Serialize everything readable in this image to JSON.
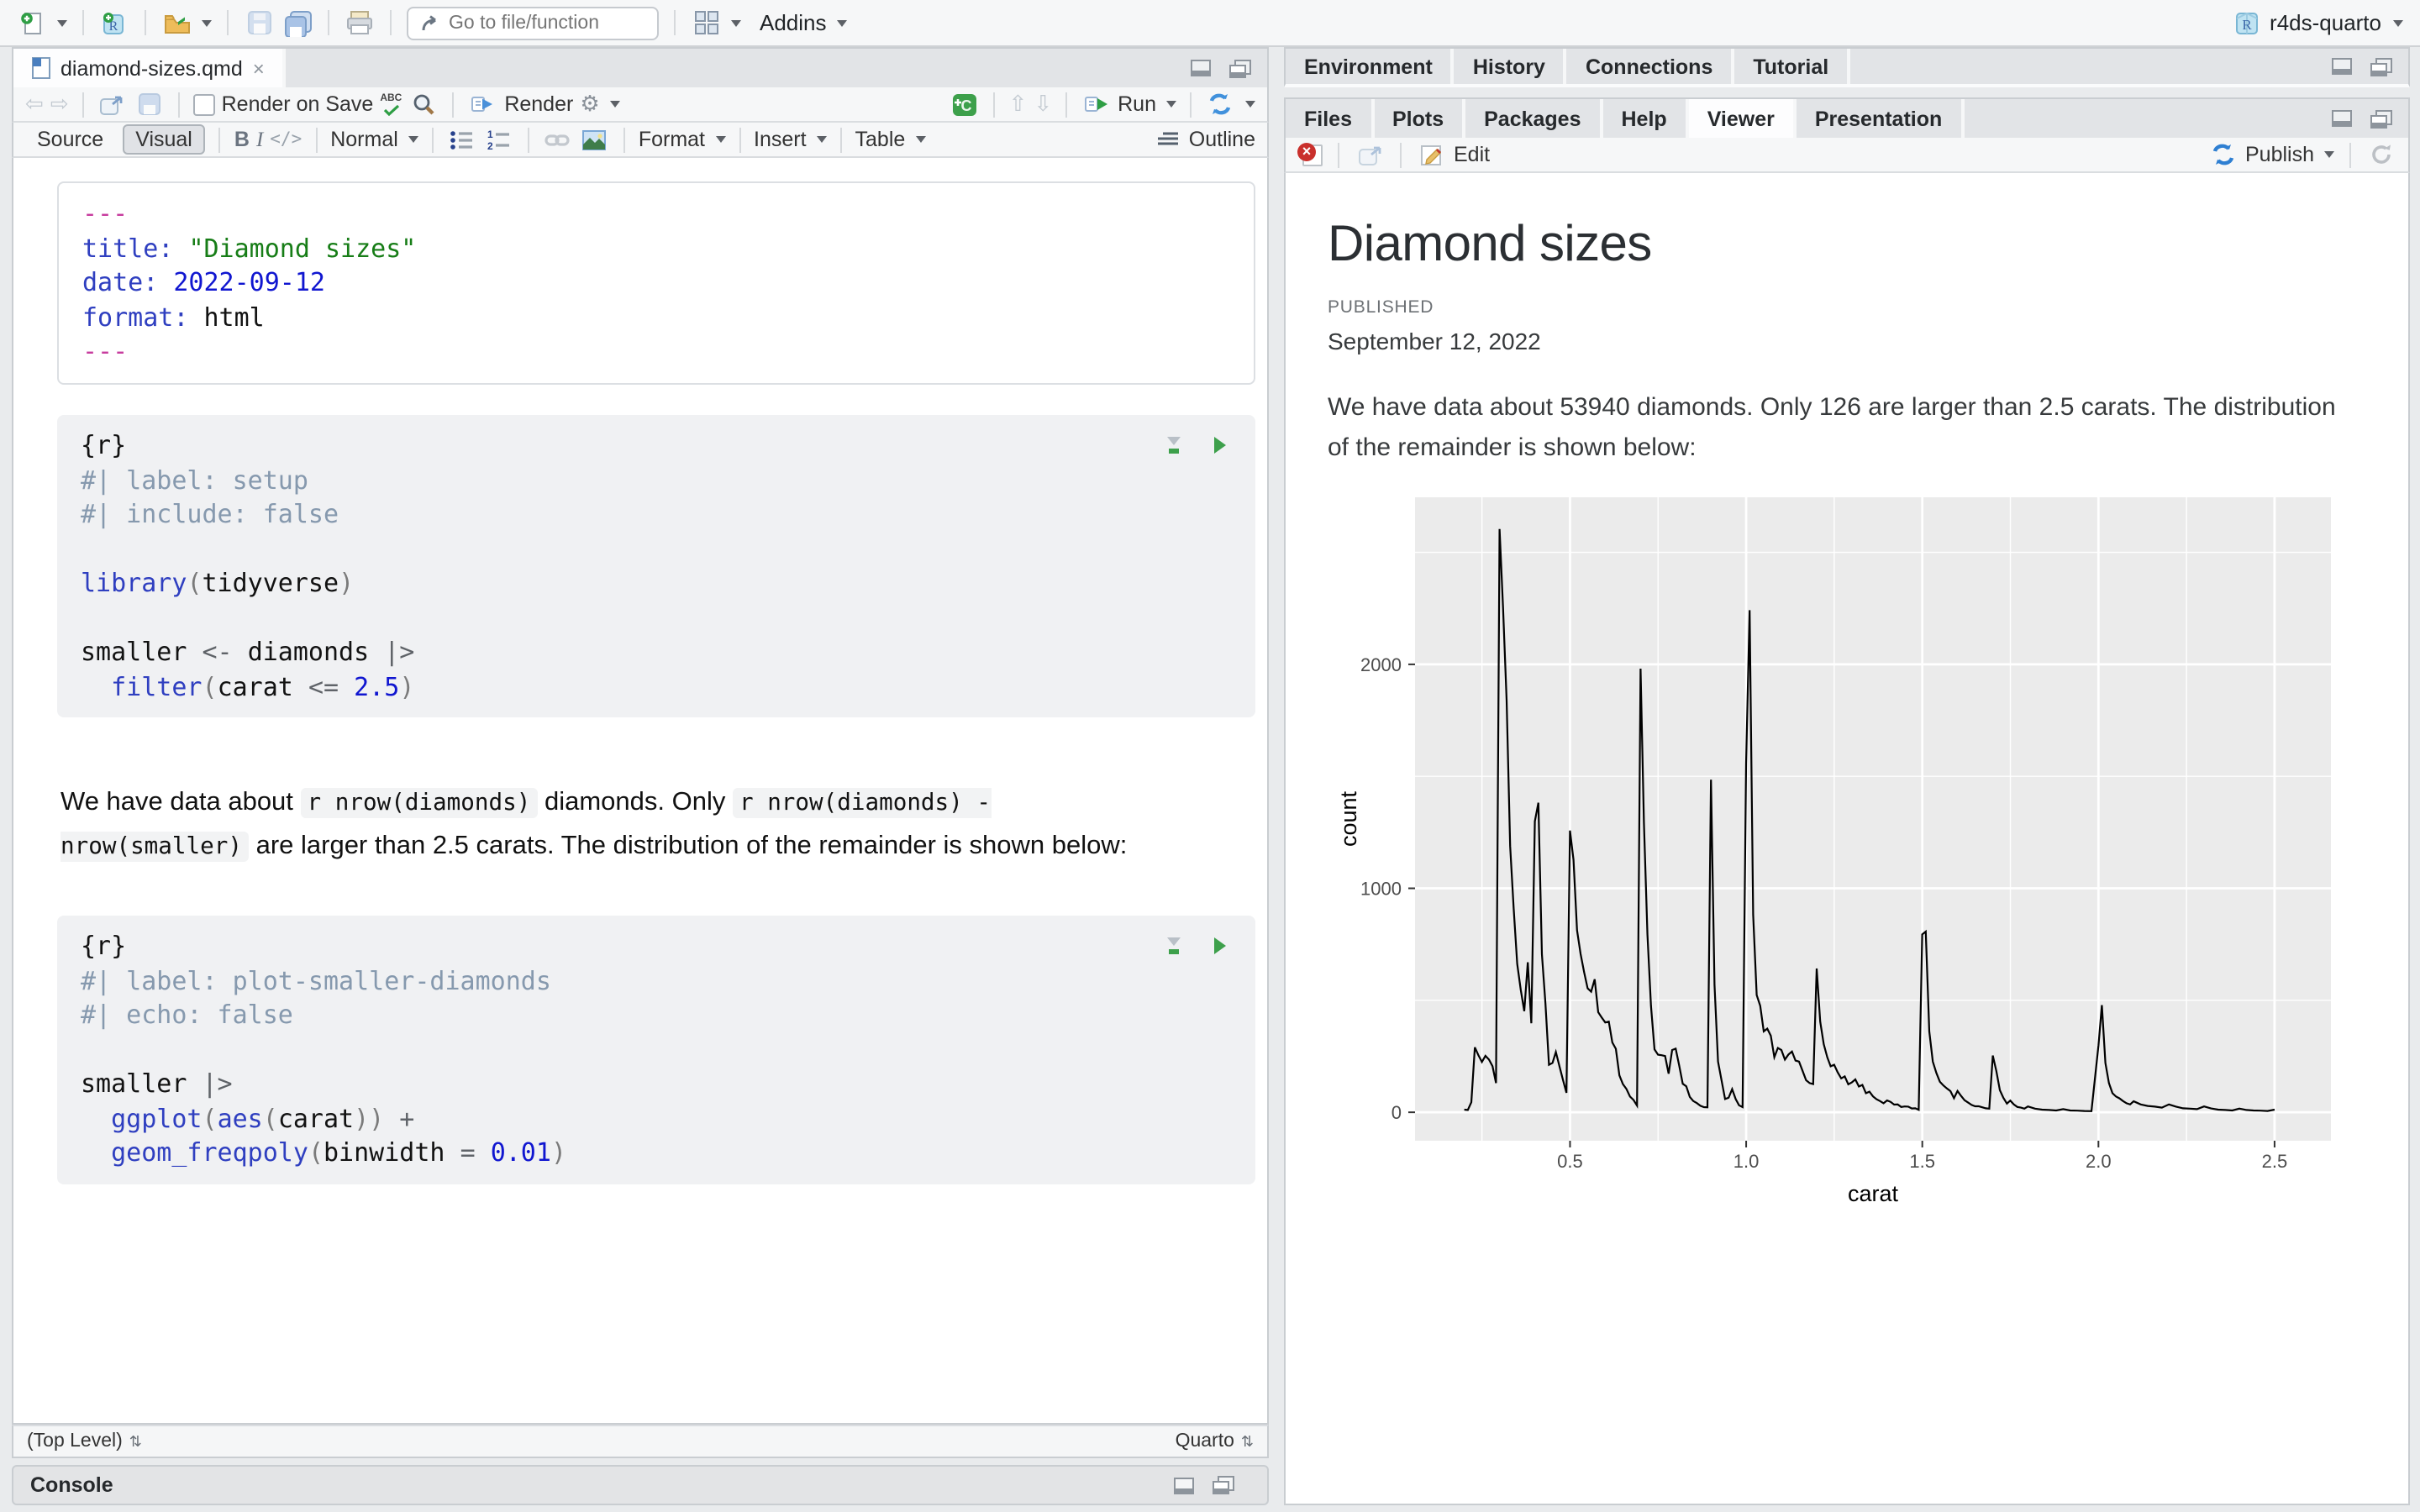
{
  "topbar": {
    "goto_placeholder": "Go to file/function",
    "addins_label": "Addins",
    "project_name": "r4ds-quarto"
  },
  "left": {
    "tab": {
      "filename": "diamond-sizes.qmd",
      "close": "×"
    },
    "toolbar": {
      "render_on_save": "Render on Save",
      "render": "Render",
      "run": "Run"
    },
    "formatbar": {
      "source": "Source",
      "visual": "Visual",
      "bold": "B",
      "italic": "I",
      "code": "</>",
      "normal": "Normal",
      "format": "Format",
      "insert": "Insert",
      "table": "Table",
      "outline": "Outline"
    },
    "editor": {
      "yaml_lines": [
        [
          [
            "y",
            "---"
          ]
        ],
        [
          [
            "k",
            "title: "
          ],
          [
            "s",
            "\"Diamond sizes\""
          ]
        ],
        [
          [
            "k",
            "date: "
          ],
          [
            "n",
            "2022-09-12"
          ]
        ],
        [
          [
            "k",
            "format: "
          ],
          [
            "t",
            "html"
          ]
        ],
        [
          [
            "y",
            "---"
          ]
        ]
      ],
      "chunk1_lines": [
        [
          [
            "t",
            "{r}"
          ]
        ],
        [
          [
            "c",
            "#| label: setup"
          ]
        ],
        [
          [
            "c",
            "#| include: false"
          ]
        ],
        [],
        [
          [
            "k",
            "library"
          ],
          [
            "p",
            "("
          ],
          [
            "t",
            "tidyverse"
          ],
          [
            "p",
            ")"
          ]
        ],
        [],
        [
          [
            "t",
            "smaller "
          ],
          [
            "o",
            "<- "
          ],
          [
            "t",
            "diamonds "
          ],
          [
            "o",
            "|>"
          ]
        ],
        [
          [
            "t",
            "  "
          ],
          [
            "k",
            "filter"
          ],
          [
            "p",
            "("
          ],
          [
            "t",
            "carat "
          ],
          [
            "o",
            "<= "
          ],
          [
            "n",
            "2.5"
          ],
          [
            "p",
            ")"
          ]
        ]
      ],
      "paragraph_parts": [
        {
          "t": "text",
          "v": "We have data about "
        },
        {
          "t": "code",
          "v": "r nrow(diamonds)"
        },
        {
          "t": "text",
          "v": " diamonds. Only "
        },
        {
          "t": "code",
          "v": "r nrow(diamonds) - nrow(smaller)"
        },
        {
          "t": "text",
          "v": " are larger than 2.5 carats. The distribution of the remainder is shown below:"
        }
      ],
      "chunk2_lines": [
        [
          [
            "t",
            "{r}"
          ]
        ],
        [
          [
            "c",
            "#| label: plot-smaller-diamonds"
          ]
        ],
        [
          [
            "c",
            "#| echo: false"
          ]
        ],
        [],
        [
          [
            "t",
            "smaller "
          ],
          [
            "o",
            "|>"
          ]
        ],
        [
          [
            "t",
            "  "
          ],
          [
            "k",
            "ggplot"
          ],
          [
            "p",
            "("
          ],
          [
            "k",
            "aes"
          ],
          [
            "p",
            "("
          ],
          [
            "t",
            "carat"
          ],
          [
            "p",
            "))"
          ],
          [
            "o",
            " +"
          ]
        ],
        [
          [
            "t",
            "  "
          ],
          [
            "k",
            "geom_freqpoly"
          ],
          [
            "p",
            "("
          ],
          [
            "t",
            "binwidth "
          ],
          [
            "o",
            "= "
          ],
          [
            "n",
            "0.01"
          ],
          [
            "p",
            ")"
          ]
        ]
      ]
    },
    "statusbar": {
      "scope": "(Top Level)",
      "mode": "Quarto"
    },
    "console": {
      "title": "Console"
    }
  },
  "right": {
    "top_tabs": [
      "Environment",
      "History",
      "Connections",
      "Tutorial"
    ],
    "bottom_tabs": [
      "Files",
      "Plots",
      "Packages",
      "Help",
      "Viewer",
      "Presentation"
    ],
    "viewer_toolbar": {
      "edit": "Edit",
      "publish": "Publish"
    },
    "document": {
      "title": "Diamond sizes",
      "published_label": "PUBLISHED",
      "date": "September 12, 2022",
      "paragraph": "We have data about 53940 diamonds. Only 126 are larger than 2.5 carats. The distribution of the remainder is shown below:"
    }
  },
  "chart_data": {
    "type": "line",
    "title": "",
    "xlabel": "carat",
    "ylabel": "count",
    "x_domain": [
      0.06,
      2.66
    ],
    "y_domain": [
      -127,
      2746
    ],
    "x_ticks": [
      0.5,
      1.0,
      1.5,
      2.0,
      2.5
    ],
    "x_tick_labels": [
      "0.5",
      "1.0",
      "1.5",
      "2.0",
      "2.5"
    ],
    "x_minor": [
      0.25,
      0.75,
      1.25,
      1.75,
      2.25
    ],
    "y_ticks": [
      0,
      1000,
      2000
    ],
    "y_tick_labels": [
      "0",
      "1000",
      "2000"
    ],
    "y_minor": [
      500,
      1500,
      2500
    ],
    "grid": true,
    "legend": "none",
    "colors": {
      "panel": "#ebebeb",
      "grid": "#ffffff",
      "line": "#000000",
      "tick_text": "#4d4d4d",
      "axis_title": "#000000"
    },
    "points": [
      [
        0.2,
        12
      ],
      [
        0.21,
        10
      ],
      [
        0.22,
        45
      ],
      [
        0.23,
        290
      ],
      [
        0.24,
        255
      ],
      [
        0.25,
        225
      ],
      [
        0.26,
        252
      ],
      [
        0.27,
        235
      ],
      [
        0.28,
        206
      ],
      [
        0.29,
        130
      ],
      [
        0.3,
        2604
      ],
      [
        0.31,
        2249
      ],
      [
        0.32,
        1840
      ],
      [
        0.33,
        1189
      ],
      [
        0.34,
        910
      ],
      [
        0.35,
        663
      ],
      [
        0.36,
        547
      ],
      [
        0.37,
        451
      ],
      [
        0.38,
        670
      ],
      [
        0.39,
        397
      ],
      [
        0.4,
        1299
      ],
      [
        0.41,
        1382
      ],
      [
        0.42,
        706
      ],
      [
        0.43,
        486
      ],
      [
        0.44,
        212
      ],
      [
        0.45,
        220
      ],
      [
        0.46,
        269
      ],
      [
        0.47,
        207
      ],
      [
        0.48,
        145
      ],
      [
        0.49,
        87
      ],
      [
        0.5,
        1258
      ],
      [
        0.51,
        1127
      ],
      [
        0.52,
        813
      ],
      [
        0.53,
        708
      ],
      [
        0.54,
        626
      ],
      [
        0.55,
        553
      ],
      [
        0.56,
        538
      ],
      [
        0.57,
        594
      ],
      [
        0.58,
        447
      ],
      [
        0.59,
        423
      ],
      [
        0.6,
        401
      ],
      [
        0.61,
        405
      ],
      [
        0.62,
        312
      ],
      [
        0.63,
        283
      ],
      [
        0.64,
        165
      ],
      [
        0.65,
        126
      ],
      [
        0.66,
        104
      ],
      [
        0.67,
        70
      ],
      [
        0.68,
        55
      ],
      [
        0.69,
        30
      ],
      [
        0.7,
        1981
      ],
      [
        0.71,
        1294
      ],
      [
        0.72,
        793
      ],
      [
        0.73,
        475
      ],
      [
        0.74,
        281
      ],
      [
        0.75,
        257
      ],
      [
        0.76,
        255
      ],
      [
        0.77,
        251
      ],
      [
        0.78,
        172
      ],
      [
        0.79,
        278
      ],
      [
        0.8,
        284
      ],
      [
        0.81,
        208
      ],
      [
        0.82,
        127
      ],
      [
        0.83,
        116
      ],
      [
        0.84,
        69
      ],
      [
        0.85,
        50
      ],
      [
        0.86,
        41
      ],
      [
        0.87,
        29
      ],
      [
        0.88,
        23
      ],
      [
        0.89,
        22
      ],
      [
        0.9,
        1485
      ],
      [
        0.91,
        570
      ],
      [
        0.92,
        226
      ],
      [
        0.93,
        142
      ],
      [
        0.94,
        59
      ],
      [
        0.95,
        65
      ],
      [
        0.96,
        103
      ],
      [
        0.97,
        59
      ],
      [
        0.98,
        31
      ],
      [
        0.99,
        23
      ],
      [
        1.0,
        1558
      ],
      [
        1.01,
        2242
      ],
      [
        1.02,
        883
      ],
      [
        1.03,
        523
      ],
      [
        1.04,
        475
      ],
      [
        1.05,
        361
      ],
      [
        1.06,
        373
      ],
      [
        1.07,
        342
      ],
      [
        1.08,
        246
      ],
      [
        1.09,
        287
      ],
      [
        1.1,
        278
      ],
      [
        1.11,
        235
      ],
      [
        1.12,
        258
      ],
      [
        1.13,
        271
      ],
      [
        1.14,
        231
      ],
      [
        1.15,
        226
      ],
      [
        1.16,
        185
      ],
      [
        1.17,
        143
      ],
      [
        1.18,
        130
      ],
      [
        1.19,
        126
      ],
      [
        1.2,
        642
      ],
      [
        1.21,
        405
      ],
      [
        1.22,
        304
      ],
      [
        1.23,
        246
      ],
      [
        1.24,
        205
      ],
      [
        1.25,
        212
      ],
      [
        1.26,
        178
      ],
      [
        1.27,
        151
      ],
      [
        1.28,
        160
      ],
      [
        1.29,
        125
      ],
      [
        1.3,
        133
      ],
      [
        1.31,
        147
      ],
      [
        1.32,
        115
      ],
      [
        1.33,
        122
      ],
      [
        1.34,
        85
      ],
      [
        1.35,
        92
      ],
      [
        1.36,
        71
      ],
      [
        1.37,
        58
      ],
      [
        1.38,
        50
      ],
      [
        1.39,
        40
      ],
      [
        1.4,
        53
      ],
      [
        1.41,
        46
      ],
      [
        1.42,
        34
      ],
      [
        1.43,
        35
      ],
      [
        1.44,
        24
      ],
      [
        1.45,
        26
      ],
      [
        1.46,
        25
      ],
      [
        1.47,
        17
      ],
      [
        1.48,
        18
      ],
      [
        1.49,
        11
      ],
      [
        1.5,
        794
      ],
      [
        1.51,
        807
      ],
      [
        1.52,
        361
      ],
      [
        1.53,
        226
      ],
      [
        1.54,
        176
      ],
      [
        1.55,
        136
      ],
      [
        1.56,
        120
      ],
      [
        1.57,
        106
      ],
      [
        1.58,
        94
      ],
      [
        1.59,
        63
      ],
      [
        1.6,
        95
      ],
      [
        1.61,
        73
      ],
      [
        1.62,
        54
      ],
      [
        1.63,
        43
      ],
      [
        1.64,
        33
      ],
      [
        1.65,
        27
      ],
      [
        1.66,
        27
      ],
      [
        1.67,
        22
      ],
      [
        1.68,
        18
      ],
      [
        1.69,
        16
      ],
      [
        1.7,
        253
      ],
      [
        1.71,
        184
      ],
      [
        1.72,
        99
      ],
      [
        1.73,
        64
      ],
      [
        1.74,
        39
      ],
      [
        1.75,
        52
      ],
      [
        1.76,
        35
      ],
      [
        1.77,
        24
      ],
      [
        1.78,
        21
      ],
      [
        1.79,
        16
      ],
      [
        1.8,
        26
      ],
      [
        1.82,
        16
      ],
      [
        1.84,
        12
      ],
      [
        1.86,
        10
      ],
      [
        1.88,
        8
      ],
      [
        1.9,
        14
      ],
      [
        1.92,
        8
      ],
      [
        1.94,
        7
      ],
      [
        1.96,
        6
      ],
      [
        1.98,
        5
      ],
      [
        2.0,
        300
      ],
      [
        2.01,
        478
      ],
      [
        2.02,
        220
      ],
      [
        2.03,
        130
      ],
      [
        2.04,
        85
      ],
      [
        2.05,
        70
      ],
      [
        2.06,
        62
      ],
      [
        2.07,
        50
      ],
      [
        2.08,
        40
      ],
      [
        2.09,
        35
      ],
      [
        2.1,
        49
      ],
      [
        2.12,
        35
      ],
      [
        2.14,
        28
      ],
      [
        2.16,
        25
      ],
      [
        2.18,
        21
      ],
      [
        2.2,
        35
      ],
      [
        2.22,
        25
      ],
      [
        2.24,
        18
      ],
      [
        2.26,
        16
      ],
      [
        2.28,
        14
      ],
      [
        2.3,
        26
      ],
      [
        2.32,
        17
      ],
      [
        2.34,
        12
      ],
      [
        2.36,
        10
      ],
      [
        2.38,
        8
      ],
      [
        2.4,
        16
      ],
      [
        2.42,
        10
      ],
      [
        2.44,
        8
      ],
      [
        2.46,
        7
      ],
      [
        2.48,
        6
      ],
      [
        2.5,
        12
      ]
    ]
  }
}
